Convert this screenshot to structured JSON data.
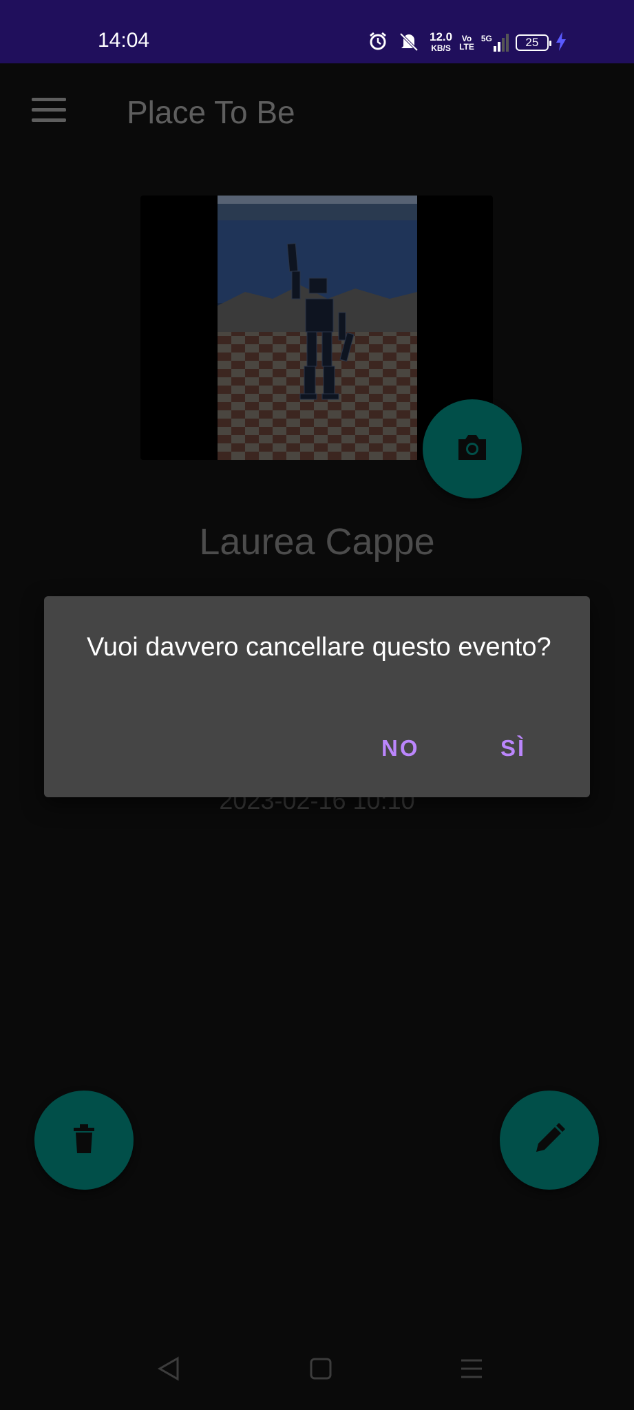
{
  "status_bar": {
    "time": "14:04",
    "net_speed_value": "12.0",
    "net_speed_unit": "KB/S",
    "volte_top": "Vo",
    "volte_bottom": "LTE",
    "network_type": "5G",
    "battery_level": "25",
    "icons": [
      "alarm-icon",
      "bell-off-icon",
      "volte-icon",
      "signal-icon",
      "battery-icon",
      "charging-icon"
    ]
  },
  "app_bar": {
    "title": "Place To Be",
    "menu_icon": "hamburger-menu-icon"
  },
  "event": {
    "title": "Laurea Cappe",
    "date": "2023-02-16 10:10"
  },
  "dialog": {
    "message": "Vuoi davvero cancellare questo evento?",
    "no_label": "NO",
    "yes_label": "SÌ"
  },
  "fabs": {
    "camera_icon": "camera-icon",
    "delete_icon": "trash-icon",
    "edit_icon": "pencil-icon"
  },
  "colors": {
    "status_bar": "#200f5c",
    "background": "#0a0a0a",
    "fab": "#014f49",
    "dialog": "#454545",
    "dialog_accent": "#bb86fc"
  }
}
